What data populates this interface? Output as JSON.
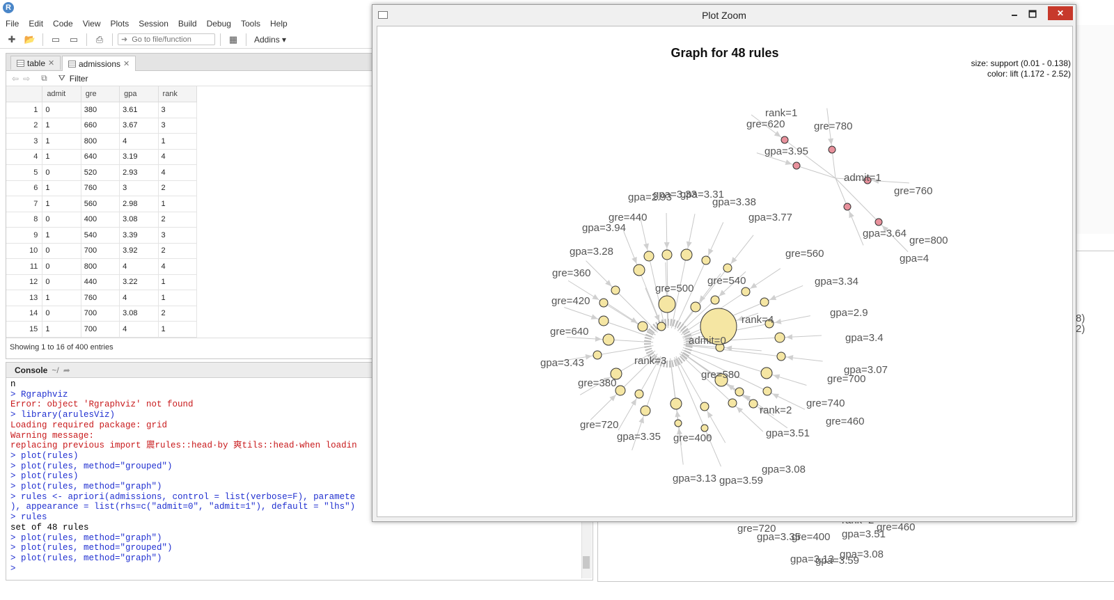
{
  "window": {
    "title_partial": "RStudio"
  },
  "menubar": [
    "File",
    "Edit",
    "Code",
    "View",
    "Plots",
    "Session",
    "Build",
    "Debug",
    "Tools",
    "Help"
  ],
  "toolbar": {
    "goto_placeholder": "Go to file/function",
    "addins_label": "Addins"
  },
  "source": {
    "tabs": [
      {
        "label": "table"
      },
      {
        "label": "admissions"
      }
    ],
    "filter_label": "Filter",
    "columns": [
      "",
      "admit",
      "gre",
      "gpa",
      "rank"
    ],
    "rows": [
      [
        "1",
        "0",
        "380",
        "3.61",
        "3"
      ],
      [
        "2",
        "1",
        "660",
        "3.67",
        "3"
      ],
      [
        "3",
        "1",
        "800",
        "4",
        "1"
      ],
      [
        "4",
        "1",
        "640",
        "3.19",
        "4"
      ],
      [
        "5",
        "0",
        "520",
        "2.93",
        "4"
      ],
      [
        "6",
        "1",
        "760",
        "3",
        "2"
      ],
      [
        "7",
        "1",
        "560",
        "2.98",
        "1"
      ],
      [
        "8",
        "0",
        "400",
        "3.08",
        "2"
      ],
      [
        "9",
        "1",
        "540",
        "3.39",
        "3"
      ],
      [
        "10",
        "0",
        "700",
        "3.92",
        "2"
      ],
      [
        "11",
        "0",
        "800",
        "4",
        "4"
      ],
      [
        "12",
        "0",
        "440",
        "3.22",
        "1"
      ],
      [
        "13",
        "1",
        "760",
        "4",
        "1"
      ],
      [
        "14",
        "0",
        "700",
        "3.08",
        "2"
      ],
      [
        "15",
        "1",
        "700",
        "4",
        "1"
      ]
    ],
    "status": "Showing 1 to 16 of 400 entries"
  },
  "console": {
    "title": "Console",
    "path": "~/",
    "lines": [
      {
        "type": "out",
        "text": "n"
      },
      {
        "type": "in",
        "text": "> Rgraphviz"
      },
      {
        "type": "err",
        "text": "Error: object 'Rgraphviz' not found"
      },
      {
        "type": "in",
        "text": "> library(arulesViz)"
      },
      {
        "type": "err",
        "text": "Loading required package: grid"
      },
      {
        "type": "err",
        "text": "Warning message:"
      },
      {
        "type": "err",
        "text": "replacing previous import 䢉rules::head·by 爽tils::head·when loadin"
      },
      {
        "type": "in",
        "text": "> plot(rules)"
      },
      {
        "type": "in",
        "text": "> plot(rules, method=\"grouped\")"
      },
      {
        "type": "in",
        "text": "> plot(rules)"
      },
      {
        "type": "in",
        "text": "> plot(rules, method=\"graph\")"
      },
      {
        "type": "in",
        "text": "> rules <- apriori(admissions, control = list(verbose=F), paramete"
      },
      {
        "type": "in",
        "text": "), appearance = list(rhs=c(\"admit=0\", \"admit=1\"), default = \"lhs\")"
      },
      {
        "type": "in",
        "text": "> rules"
      },
      {
        "type": "out",
        "text": "set of 48 rules"
      },
      {
        "type": "in",
        "text": "> plot(rules, method=\"graph\")"
      },
      {
        "type": "in",
        "text": "> plot(rules, method=\"grouped\")"
      },
      {
        "type": "in",
        "text": "> plot(rules, method=\"graph\")"
      },
      {
        "type": "in",
        "text": "> "
      }
    ]
  },
  "background_plot": {
    "labels": [
      "gre=720",
      "gpa=3.35",
      "gre=400",
      "rank=2",
      "gre=460",
      "gpa=3.51",
      "gpa=3.08",
      "gpa=3.13",
      "gpa=3.59",
      "8)",
      "2)"
    ]
  },
  "zoom": {
    "title": "Plot Zoom",
    "plot_title": "Graph for 48 rules",
    "legend_size": "size: support (0.01 - 0.138)",
    "legend_color": "color: lift (1.172 - 2.52)",
    "colors": {
      "rule_low_lift": "#f5e6a3",
      "rule_high_lift": "#e8919c",
      "edge": "#c8c8c8",
      "label": "#555555"
    },
    "hubs": [
      {
        "label": "admit=0",
        "kind": "rhs"
      },
      {
        "label": "admit=1",
        "kind": "rhs"
      }
    ],
    "item_labels": [
      "rank=1",
      "gre=620",
      "gre=780",
      "gpa=3.95",
      "admit=1",
      "gre=760",
      "gpa=3.64",
      "gre=800",
      "gpa=4",
      "gpa=2.93",
      "gpa=3.33",
      "gpa=3.31",
      "gpa=3.38",
      "gpa=3.77",
      "gre=440",
      "gpa=3.94",
      "gpa=3.28",
      "gre=560",
      "gre=360",
      "gre=500",
      "gre=540",
      "gpa=3.34",
      "gre=420",
      "gpa=2.9",
      "rank=4",
      "gre=640",
      "gpa=3.4",
      "admit=0",
      "gpa=3.43",
      "rank=3",
      "gpa=3.07",
      "gre=580",
      "gre=700",
      "gre=380",
      "gre=740",
      "rank=2",
      "gre=720",
      "gre=460",
      "gpa=3.35",
      "gre=400",
      "gpa=3.51",
      "gpa=3.08",
      "gpa=3.13",
      "gpa=3.59"
    ]
  }
}
